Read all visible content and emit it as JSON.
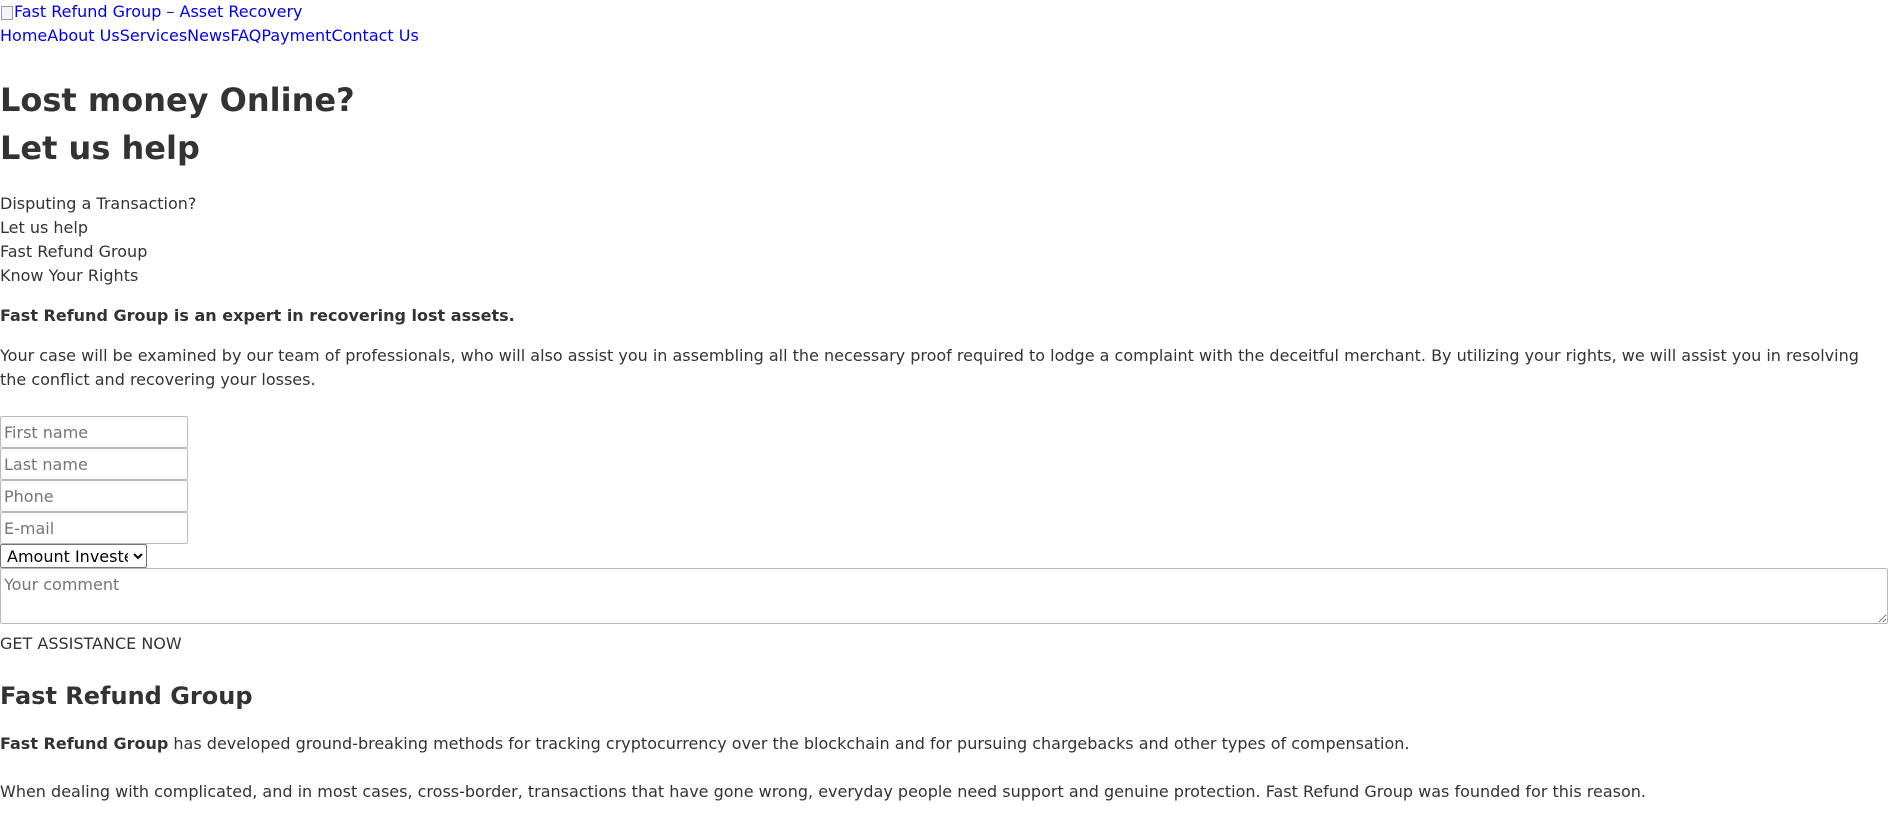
{
  "header": {
    "logo_alt": "Fast Refund Group – Asset Recovery",
    "nav": [
      {
        "label": "Home"
      },
      {
        "label": "About Us"
      },
      {
        "label": "Services"
      },
      {
        "label": "News"
      },
      {
        "label": "FAQ"
      },
      {
        "label": "Payment"
      },
      {
        "label": "Contact Us"
      }
    ]
  },
  "hero": {
    "title_line1": "Lost money Online?",
    "title_line2": "Let us help",
    "lines": [
      "Disputing a Transaction?",
      "Let us help",
      "Fast Refund Group",
      "Know Your Rights"
    ],
    "expert": "Fast Refund Group is an expert in recovering lost assets.",
    "intro": "Your case will be examined by our team of professionals, who will also assist you in assembling all the necessary proof required to lodge a complaint with the deceitful merchant. By utilizing your rights, we will assist you in resolving the conflict and recovering your losses."
  },
  "form": {
    "first_name_placeholder": "First name",
    "last_name_placeholder": "Last name",
    "phone_placeholder": "Phone",
    "email_placeholder": "E-mail",
    "amount_selected": "Amount Invested",
    "comment_placeholder": "Your comment",
    "submit_label": "GET ASSISTANCE NOW"
  },
  "about": {
    "heading": "Fast Refund Group",
    "p1_bold": "Fast Refund Group",
    "p1_rest": " has developed ground-breaking methods for tracking cryptocurrency over the blockchain and for pursuing chargebacks and other types of compensation.",
    "p2": "When dealing with complicated, and in most cases, cross-border, transactions that have gone wrong, everyday people need support and genuine protection. Fast Refund Group was founded for this reason."
  }
}
